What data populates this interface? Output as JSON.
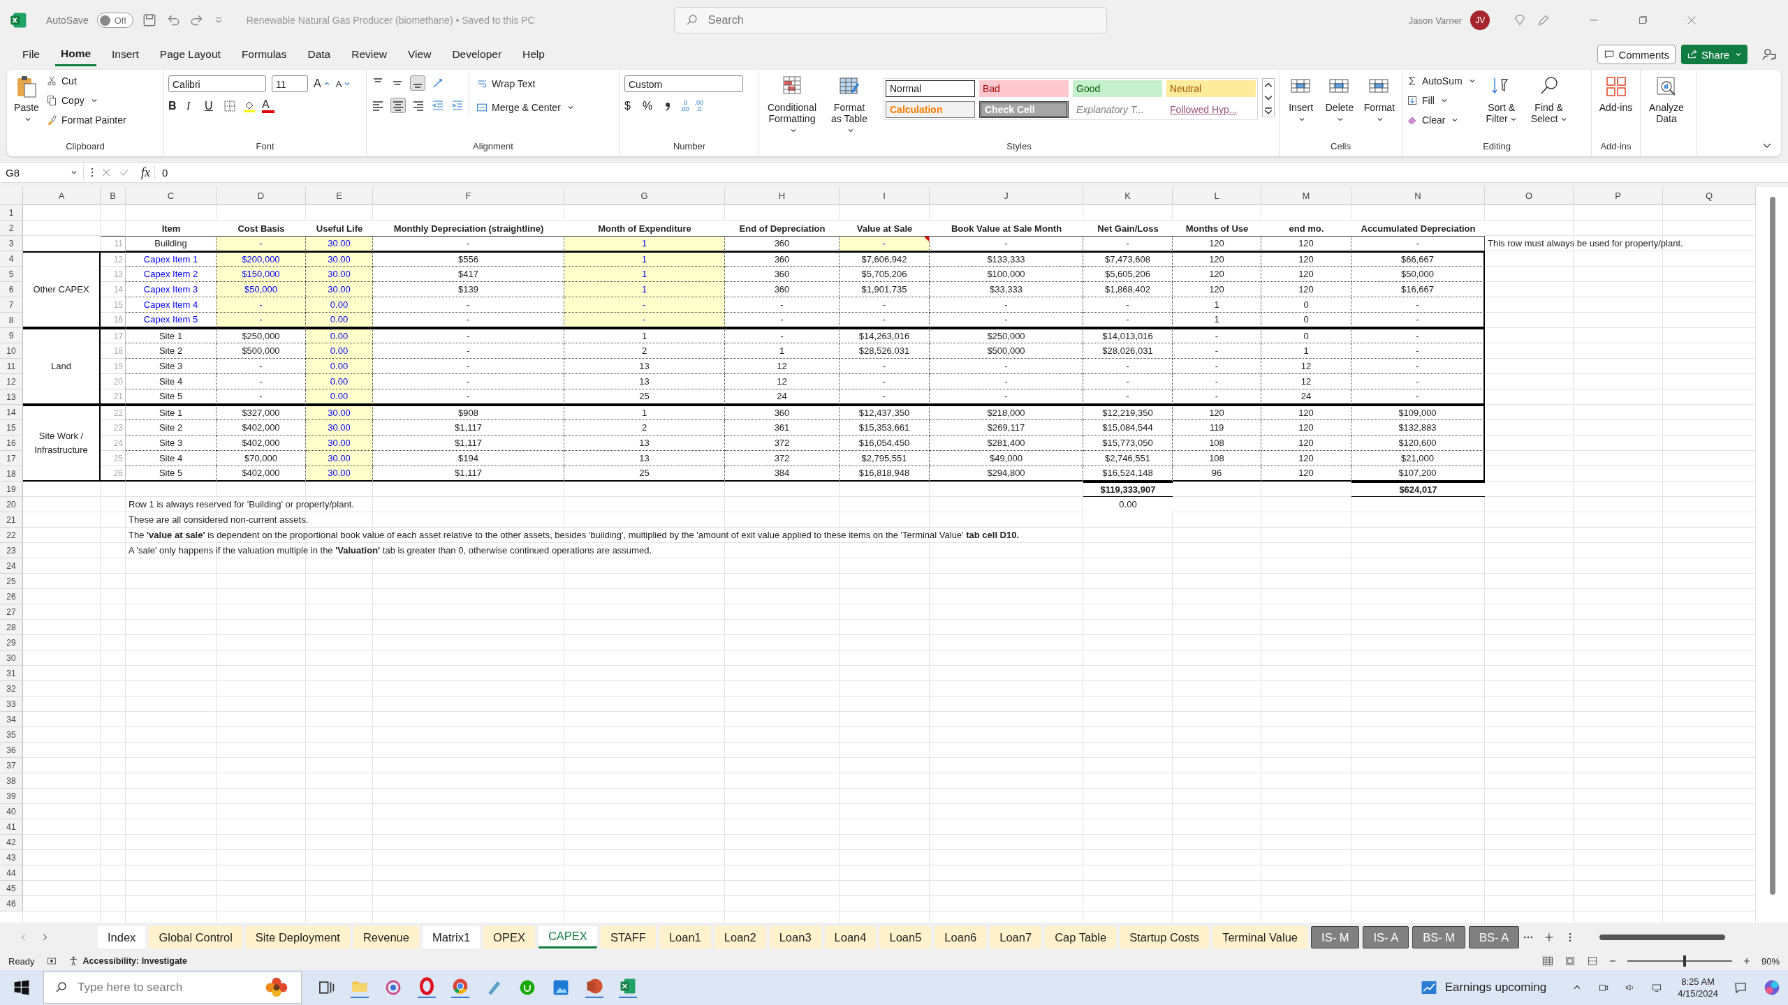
{
  "title_bar": {
    "autosave": "AutoSave",
    "autosave_on": false,
    "toggle_label": "Off",
    "title": "Renewable Natural Gas Producer (biomethane) • Saved to this PC",
    "search_placeholder": "Search",
    "user": "Jason Varner",
    "avatar": "JV"
  },
  "menu_tabs": [
    {
      "label": "File",
      "selected": false
    },
    {
      "label": "Home",
      "selected": true
    },
    {
      "label": "Insert",
      "selected": false
    },
    {
      "label": "Page Layout",
      "selected": false
    },
    {
      "label": "Formulas",
      "selected": false
    },
    {
      "label": "Data",
      "selected": false
    },
    {
      "label": "Review",
      "selected": false
    },
    {
      "label": "View",
      "selected": false
    },
    {
      "label": "Developer",
      "selected": false
    },
    {
      "label": "Help",
      "selected": false
    }
  ],
  "comments_button": "Comments",
  "share_button": "Share",
  "ribbon": {
    "clipboard": {
      "label": "Clipboard",
      "paste": "Paste",
      "cut": "Cut",
      "copy": "Copy",
      "format_painter": "Format Painter"
    },
    "font": {
      "label": "Font",
      "family": "Calibri",
      "size": "11",
      "grow": "A",
      "shrink": "A",
      "bold": "B",
      "italic": "I",
      "underline": "U",
      "color_letter": "A"
    },
    "alignment": {
      "label": "Alignment",
      "wrap": "Wrap Text",
      "merge": "Merge & Center"
    },
    "number": {
      "label": "Number",
      "format": "Custom",
      "currency": "$",
      "percent": "%",
      "increase_decimal": [
        ".0",
        ".00"
      ],
      "decrease_decimal": [
        ".00",
        ".0"
      ]
    },
    "styles": {
      "label": "Styles",
      "conditional": "Conditional Formatting",
      "format_table": "Format as Table",
      "gallery": [
        {
          "text": "Normal",
          "kind": "normal"
        },
        {
          "text": "Bad",
          "kind": "bad"
        },
        {
          "text": "Good",
          "kind": "good"
        },
        {
          "text": "Neutral",
          "kind": "neutral"
        },
        {
          "text": "Calculation",
          "kind": "calculation"
        },
        {
          "text": "Check Cell",
          "kind": "check"
        },
        {
          "text": "Explanatory T...",
          "kind": "explanatory"
        },
        {
          "text": "Followed Hyp...",
          "kind": "followed"
        }
      ]
    },
    "cells": {
      "label": "Cells",
      "buttons": [
        "Insert",
        "Delete",
        "Format"
      ]
    },
    "editing": {
      "label": "Editing",
      "autosum": "AutoSum",
      "fill": "Fill",
      "clear": "Clear",
      "sort": "Sort & Filter",
      "find": "Find & Select"
    },
    "addins": {
      "label": "Add-ins",
      "button": "Add-ins"
    },
    "analyze": "Analyze Data"
  },
  "formula_bar": {
    "name_box": "G8",
    "fx": "fx",
    "formula": "0"
  },
  "sheet": {
    "column_letters": [
      "A",
      "B",
      "C",
      "D",
      "E",
      "F",
      "G",
      "H",
      "I",
      "J",
      "K",
      "L",
      "M",
      "N",
      "O",
      "P",
      "Q"
    ],
    "row_numbers": [
      "1",
      "2",
      "3",
      "4",
      "5",
      "6",
      "7",
      "8",
      "9",
      "10",
      "11",
      "12",
      "13",
      "14",
      "15",
      "16",
      "17",
      "18",
      "19",
      "20",
      "21",
      "22",
      "23",
      "24",
      "25",
      "26",
      "27",
      "28",
      "29",
      "30",
      "31",
      "32",
      "33",
      "34",
      "35",
      "36",
      "37",
      "38",
      "39",
      "40",
      "41",
      "42",
      "43",
      "44",
      "45",
      "46"
    ],
    "header": [
      "Item",
      "Cost Basis",
      "Useful Life",
      "Monthly Depreciation (straightline)",
      "Month of Expenditure",
      "End of Depreciation",
      "Value at Sale",
      "Book Value at Sale Month",
      "Net Gain/Loss",
      "Months of Use",
      "end mo.",
      "Accumulated Depreciation"
    ],
    "groups": [
      {
        "rows": [
          {
            "index": "11",
            "cells": [
              "Building",
              {
                "text": "-",
                "kind": "input"
              },
              {
                "text": "30.00",
                "kind": "input"
              },
              "-",
              {
                "text": "1",
                "kind": "input"
              },
              "360",
              {
                "text": "-",
                "kind": "input",
                "comment": true
              },
              "-",
              "-",
              "120",
              "120",
              "-"
            ]
          }
        ]
      },
      {
        "label": "Other CAPEX",
        "rows": [
          {
            "index": "12",
            "cells": [
              {
                "text": "Capex Item 1",
                "kind": "link"
              },
              {
                "text": "$200,000",
                "kind": "input"
              },
              {
                "text": "30.00",
                "kind": "input"
              },
              "$556",
              {
                "text": "1",
                "kind": "input"
              },
              "360",
              "$7,606,942",
              "$133,333",
              "$7,473,608",
              "120",
              "120",
              "$66,667"
            ]
          },
          {
            "index": "13",
            "cells": [
              {
                "text": "Capex Item 2",
                "kind": "link"
              },
              {
                "text": "$150,000",
                "kind": "input"
              },
              {
                "text": "30.00",
                "kind": "input"
              },
              "$417",
              {
                "text": "1",
                "kind": "input"
              },
              "360",
              "$5,705,206",
              "$100,000",
              "$5,605,206",
              "120",
              "120",
              "$50,000"
            ]
          },
          {
            "index": "14",
            "cells": [
              {
                "text": "Capex Item 3",
                "kind": "link"
              },
              {
                "text": "$50,000",
                "kind": "input"
              },
              {
                "text": "30.00",
                "kind": "input"
              },
              "$139",
              {
                "text": "1",
                "kind": "input"
              },
              "360",
              "$1,901,735",
              "$33,333",
              "$1,868,402",
              "120",
              "120",
              "$16,667"
            ]
          },
          {
            "index": "15",
            "cells": [
              {
                "text": "Capex Item 4",
                "kind": "link"
              },
              {
                "text": "-",
                "kind": "input"
              },
              {
                "text": "0.00",
                "kind": "input"
              },
              "-",
              {
                "text": "-",
                "kind": "input"
              },
              "-",
              "-",
              "-",
              "-",
              "1",
              "0",
              "-"
            ]
          },
          {
            "index": "16",
            "cells": [
              {
                "text": "Capex Item 5",
                "kind": "link"
              },
              {
                "text": "-",
                "kind": "input"
              },
              {
                "text": "0.00",
                "kind": "input"
              },
              "-",
              {
                "text": "-",
                "kind": "input"
              },
              "-",
              "-",
              "-",
              "-",
              "1",
              "0",
              "-"
            ]
          }
        ]
      },
      {
        "label": "Land",
        "rows": [
          {
            "index": "17",
            "cells": [
              "Site 1",
              "$250,000",
              {
                "text": "0.00",
                "kind": "input"
              },
              "-",
              "1",
              "-",
              "$14,263,016",
              "$250,000",
              "$14,013,016",
              "-",
              "0",
              "-"
            ]
          },
          {
            "index": "18",
            "cells": [
              "Site 2",
              "$500,000",
              {
                "text": "0.00",
                "kind": "input"
              },
              "-",
              "2",
              "1",
              "$28,526,031",
              "$500,000",
              "$28,026,031",
              "-",
              "1",
              "-"
            ]
          },
          {
            "index": "19",
            "cells": [
              "Site 3",
              "-",
              {
                "text": "0.00",
                "kind": "input"
              },
              "-",
              "13",
              "12",
              "-",
              "-",
              "-",
              "-",
              "12",
              "-"
            ]
          },
          {
            "index": "20",
            "cells": [
              "Site 4",
              "-",
              {
                "text": "0.00",
                "kind": "input"
              },
              "-",
              "13",
              "12",
              "-",
              "-",
              "-",
              "-",
              "12",
              "-"
            ]
          },
          {
            "index": "21",
            "cells": [
              "Site 5",
              "-",
              {
                "text": "0.00",
                "kind": "input"
              },
              "-",
              "25",
              "24",
              "-",
              "-",
              "-",
              "-",
              "24",
              "-"
            ]
          }
        ]
      },
      {
        "label": "Site Work / Infrastructure",
        "rows": [
          {
            "index": "22",
            "cells": [
              "Site 1",
              "$327,000",
              {
                "text": "30.00",
                "kind": "input"
              },
              "$908",
              "1",
              "360",
              "$12,437,350",
              "$218,000",
              "$12,219,350",
              "120",
              "120",
              "$109,000"
            ]
          },
          {
            "index": "23",
            "cells": [
              "Site 2",
              "$402,000",
              {
                "text": "30.00",
                "kind": "input"
              },
              "$1,117",
              "2",
              "361",
              "$15,353,661",
              "$269,117",
              "$15,084,544",
              "119",
              "120",
              "$132,883"
            ]
          },
          {
            "index": "24",
            "cells": [
              "Site 3",
              "$402,000",
              {
                "text": "30.00",
                "kind": "input"
              },
              "$1,117",
              "13",
              "372",
              "$16,054,450",
              "$281,400",
              "$15,773,050",
              "108",
              "120",
              "$120,600"
            ]
          },
          {
            "index": "25",
            "cells": [
              "Site 4",
              "$70,000",
              {
                "text": "30.00",
                "kind": "input"
              },
              "$194",
              "13",
              "372",
              "$2,795,551",
              "$49,000",
              "$2,746,551",
              "108",
              "120",
              "$21,000"
            ]
          },
          {
            "index": "26",
            "cells": [
              "Site 5",
              "$402,000",
              {
                "text": "30.00",
                "kind": "input"
              },
              "$1,117",
              "25",
              "384",
              "$16,818,948",
              "$294,800",
              "$16,524,148",
              "96",
              "120",
              "$107,200"
            ]
          }
        ]
      }
    ],
    "totals": {
      "net_gain_loss": "$119,333,907",
      "accumulated_depreciation": "$624,017"
    },
    "check_value": "0.00",
    "side_note": "This row must always be used for property/plant.",
    "notes": [
      "Row 1 is always reserved for 'Building' or property/plant.",
      "These are all considered non-current assets.",
      "The **'value at sale'** is dependent on the proportional book value of each asset relative to the other assets, besides 'building', multiplied by the 'amount of exit value applied to these items on the 'Terminal Value' **tab cell D10.**",
      "A 'sale' only happens if the valuation multiple in the **'Valuation'** tab is greater than 0, otherwise continued operations are assumed."
    ]
  },
  "sheet_tabs": [
    {
      "label": "Index",
      "color": "#ffffff",
      "selected": false
    },
    {
      "label": "Global Control",
      "color": "#fff2cc",
      "selected": false
    },
    {
      "label": "Site Deployment",
      "color": "#fff2cc",
      "selected": false
    },
    {
      "label": "Revenue",
      "color": "#fff2cc",
      "selected": false
    },
    {
      "label": "Matrix1",
      "color": "#ffffff",
      "selected": false
    },
    {
      "label": "OPEX",
      "color": "#fff2cc",
      "selected": false
    },
    {
      "label": "CAPEX",
      "color": "#ffffff",
      "selected": true
    },
    {
      "label": "STAFF",
      "color": "#fff2cc",
      "selected": false
    },
    {
      "label": "Loan1",
      "color": "#fff2cc",
      "selected": false
    },
    {
      "label": "Loan2",
      "color": "#fff2cc",
      "selected": false
    },
    {
      "label": "Loan3",
      "color": "#fff2cc",
      "selected": false
    },
    {
      "label": "Loan4",
      "color": "#fff2cc",
      "selected": false
    },
    {
      "label": "Loan5",
      "color": "#fff2cc",
      "selected": false
    },
    {
      "label": "Loan6",
      "color": "#fff2cc",
      "selected": false
    },
    {
      "label": "Loan7",
      "color": "#fff2cc",
      "selected": false
    },
    {
      "label": "Cap Table",
      "color": "#fff2cc",
      "selected": false
    },
    {
      "label": "Startup Costs",
      "color": "#fff2cc",
      "selected": false
    },
    {
      "label": "Terminal Value",
      "color": "#fff2cc",
      "selected": false
    },
    {
      "label": "IS- M",
      "color": "#808080",
      "selected": false
    },
    {
      "label": "IS- A",
      "color": "#808080",
      "selected": false
    },
    {
      "label": "BS- M",
      "color": "#808080",
      "selected": false
    },
    {
      "label": "BS- A",
      "color": "#808080",
      "selected": false
    }
  ],
  "status_bar": {
    "ready": "Ready",
    "accessibility": "Accessibility: Investigate",
    "zoom": "90%",
    "zoom_slider": {
      "level": 0.55
    }
  },
  "taskbar": {
    "search_placeholder": "Type here to search",
    "news": "Earnings upcoming",
    "time": "8:25 AM",
    "date": "4/15/2024"
  }
}
